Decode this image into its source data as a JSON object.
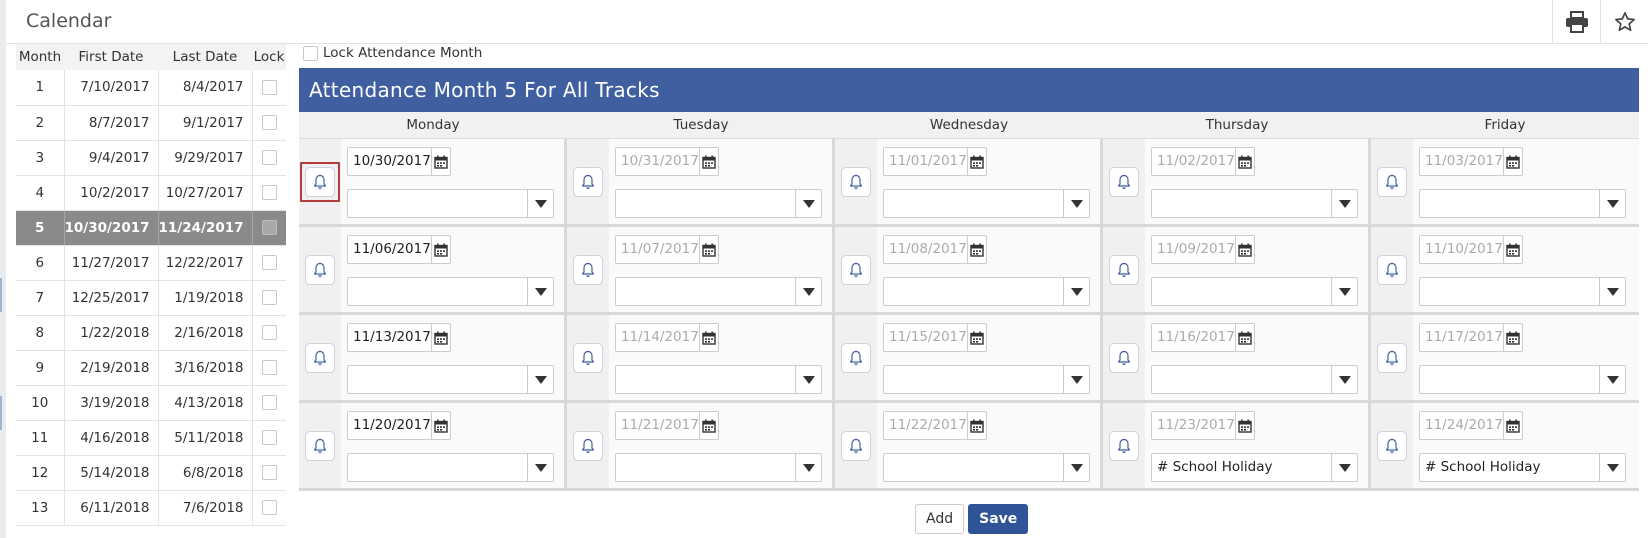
{
  "window": {
    "title": "Calendar"
  },
  "toolbar": {
    "print_icon": "print-icon",
    "favorite_icon": "star-icon"
  },
  "months_table": {
    "headers": [
      "Month",
      "First Date",
      "Last Date",
      "Lock"
    ],
    "selected_month": "5",
    "rows": [
      {
        "month": "1",
        "first": "7/10/2017",
        "last": "8/4/2017"
      },
      {
        "month": "2",
        "first": "8/7/2017",
        "last": "9/1/2017"
      },
      {
        "month": "3",
        "first": "9/4/2017",
        "last": "9/29/2017"
      },
      {
        "month": "4",
        "first": "10/2/2017",
        "last": "10/27/2017"
      },
      {
        "month": "5",
        "first": "10/30/2017",
        "last": "11/24/2017"
      },
      {
        "month": "6",
        "first": "11/27/2017",
        "last": "12/22/2017"
      },
      {
        "month": "7",
        "first": "12/25/2017",
        "last": "1/19/2018"
      },
      {
        "month": "8",
        "first": "1/22/2018",
        "last": "2/16/2018"
      },
      {
        "month": "9",
        "first": "2/19/2018",
        "last": "3/16/2018"
      },
      {
        "month": "10",
        "first": "3/19/2018",
        "last": "4/13/2018"
      },
      {
        "month": "11",
        "first": "4/16/2018",
        "last": "5/11/2018"
      },
      {
        "month": "12",
        "first": "5/14/2018",
        "last": "6/8/2018"
      },
      {
        "month": "13",
        "first": "6/11/2018",
        "last": "7/6/2018"
      }
    ]
  },
  "lock_month": {
    "label": "Lock Attendance Month",
    "checked": false
  },
  "panel": {
    "title": "Attendance Month 5 For All Tracks"
  },
  "weekdays": [
    "Monday",
    "Tuesday",
    "Wednesday",
    "Thursday",
    "Friday"
  ],
  "weeks": [
    [
      {
        "date": "10/30/2017",
        "enabled": true,
        "code": ""
      },
      {
        "date": "10/31/2017",
        "enabled": false,
        "code": ""
      },
      {
        "date": "11/01/2017",
        "enabled": false,
        "code": ""
      },
      {
        "date": "11/02/2017",
        "enabled": false,
        "code": ""
      },
      {
        "date": "11/03/2017",
        "enabled": false,
        "code": ""
      }
    ],
    [
      {
        "date": "11/06/2017",
        "enabled": true,
        "code": ""
      },
      {
        "date": "11/07/2017",
        "enabled": false,
        "code": ""
      },
      {
        "date": "11/08/2017",
        "enabled": false,
        "code": ""
      },
      {
        "date": "11/09/2017",
        "enabled": false,
        "code": ""
      },
      {
        "date": "11/10/2017",
        "enabled": false,
        "code": ""
      }
    ],
    [
      {
        "date": "11/13/2017",
        "enabled": true,
        "code": ""
      },
      {
        "date": "11/14/2017",
        "enabled": false,
        "code": ""
      },
      {
        "date": "11/15/2017",
        "enabled": false,
        "code": ""
      },
      {
        "date": "11/16/2017",
        "enabled": false,
        "code": ""
      },
      {
        "date": "11/17/2017",
        "enabled": false,
        "code": ""
      }
    ],
    [
      {
        "date": "11/20/2017",
        "enabled": true,
        "code": ""
      },
      {
        "date": "11/21/2017",
        "enabled": false,
        "code": ""
      },
      {
        "date": "11/22/2017",
        "enabled": false,
        "code": ""
      },
      {
        "date": "11/23/2017",
        "enabled": false,
        "code": "#  School Holiday"
      },
      {
        "date": "11/24/2017",
        "enabled": false,
        "code": "#  School Holiday"
      }
    ]
  ],
  "focused_cell": {
    "week": 0,
    "day": 0
  },
  "actions": {
    "add_label": "Add",
    "save_label": "Save"
  },
  "colors": {
    "header_bar": "#3f5fa0",
    "save_button": "#2f5598",
    "selected_row": "#8a8a8a",
    "focus_outline": "#b13a3a"
  }
}
